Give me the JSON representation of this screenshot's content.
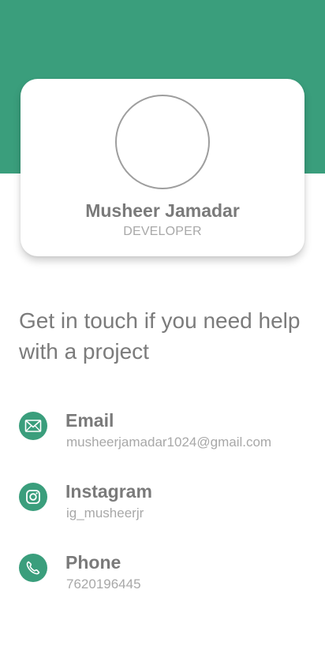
{
  "colors": {
    "accent": "#3a9e7c",
    "card_background": "#ffffff",
    "heading_text": "#7a7a7a",
    "secondary_text": "#a8a8a8"
  },
  "profile": {
    "name": "Musheer Jamadar",
    "role": "DEVELOPER"
  },
  "tagline": "Get in touch if you need help with a project",
  "contacts": [
    {
      "icon": "mail-icon",
      "title": "Email",
      "value": "musheerjamadar1024@gmail.com"
    },
    {
      "icon": "instagram-icon",
      "title": "Instagram",
      "value": "ig_musheerjr"
    },
    {
      "icon": "phone-icon",
      "title": "Phone",
      "value": "7620196445"
    }
  ]
}
